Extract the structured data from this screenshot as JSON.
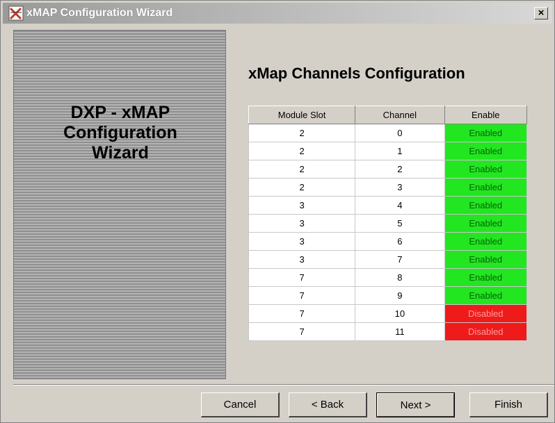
{
  "window": {
    "title": "xMAP Configuration Wizard",
    "close_label": "×"
  },
  "sidebar": {
    "title": "DXP - xMAP\nConfiguration\nWizard"
  },
  "main": {
    "heading": "xMap Channels Configuration",
    "table": {
      "headers": [
        "Module Slot",
        "Channel",
        "Enable"
      ],
      "rows": [
        {
          "slot": "2",
          "channel": "0",
          "enable": "Enabled"
        },
        {
          "slot": "2",
          "channel": "1",
          "enable": "Enabled"
        },
        {
          "slot": "2",
          "channel": "2",
          "enable": "Enabled"
        },
        {
          "slot": "2",
          "channel": "3",
          "enable": "Enabled"
        },
        {
          "slot": "3",
          "channel": "4",
          "enable": "Enabled"
        },
        {
          "slot": "3",
          "channel": "5",
          "enable": "Enabled"
        },
        {
          "slot": "3",
          "channel": "6",
          "enable": "Enabled"
        },
        {
          "slot": "3",
          "channel": "7",
          "enable": "Enabled"
        },
        {
          "slot": "7",
          "channel": "8",
          "enable": "Enabled"
        },
        {
          "slot": "7",
          "channel": "9",
          "enable": "Enabled"
        },
        {
          "slot": "7",
          "channel": "10",
          "enable": "Disabled"
        },
        {
          "slot": "7",
          "channel": "11",
          "enable": "Disabled"
        }
      ]
    }
  },
  "buttons": {
    "cancel": "Cancel",
    "back": "< Back",
    "next": "Next >",
    "finish": "Finish"
  },
  "colors": {
    "enabled": "#22e620",
    "disabled": "#ef1a1a"
  },
  "icons": {
    "app": "xmap-app-icon",
    "close": "close-icon"
  }
}
